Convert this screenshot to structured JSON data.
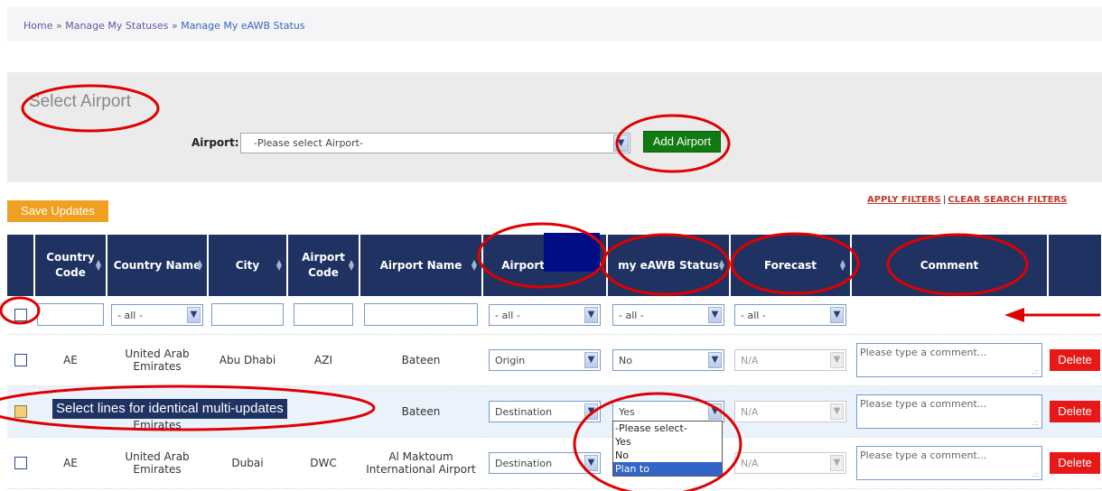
{
  "breadcrumb": {
    "home": "Home",
    "sep": " » ",
    "manage_statuses": "Manage My Statuses",
    "current": "Manage My eAWB Status"
  },
  "select_panel": {
    "title": "Select Airport",
    "airport_label": "Airport:",
    "airport_placeholder": "-Please select Airport-",
    "add_button": "Add Airport"
  },
  "toolbar": {
    "save_label": "Save Updates",
    "apply_filters": "APPLY FILTERS",
    "separator": "|",
    "clear_filters": "CLEAR SEARCH FILTERS"
  },
  "table": {
    "headers": {
      "country_code": "Country Code",
      "country_name": "Country Name",
      "city": "City",
      "airport_code": "Airport Code",
      "airport_name": "Airport Name",
      "airport_type": "Airport e Type",
      "my_status": "my eAWB Status",
      "forecast": "Forecast",
      "comment": "Comment"
    },
    "filters": {
      "all": "- all -"
    },
    "rows": [
      {
        "country_code": "AE",
        "country_name": "United Arab Emirates",
        "city": "Abu Dhabi",
        "airport_code": "AZI",
        "airport_name": "Bateen",
        "type": "Origin",
        "status": "No",
        "forecast": "N/A",
        "comment_placeholder": "Please type a comment...",
        "delete": "Delete"
      },
      {
        "country_code": "",
        "country_name": "Emirates",
        "city": "",
        "airport_code": "",
        "airport_name": "Bateen",
        "type": "Destination",
        "status": "Yes",
        "forecast": "N/A",
        "comment_placeholder": "Please type a comment...",
        "delete": "Delete"
      },
      {
        "country_code": "AE",
        "country_name": "United Arab Emirates",
        "city": "Dubai",
        "airport_code": "DWC",
        "airport_name": "Al Maktoum International Airport",
        "type": "Destination",
        "status": "",
        "forecast": "N/A",
        "comment_placeholder": "Please type a comment...",
        "delete": "Delete"
      }
    ]
  },
  "status_dropdown": {
    "options": [
      "-Please select-",
      "Yes",
      "No",
      "Plan to"
    ],
    "highlighted": "Plan to"
  },
  "tooltip": "Select lines for identical multi-updates",
  "colors": {
    "header_bg": "#1f3261",
    "add_button": "#127a12",
    "save_button": "#f0a020",
    "delete_button": "#e81818",
    "annotation": "#e00000"
  }
}
